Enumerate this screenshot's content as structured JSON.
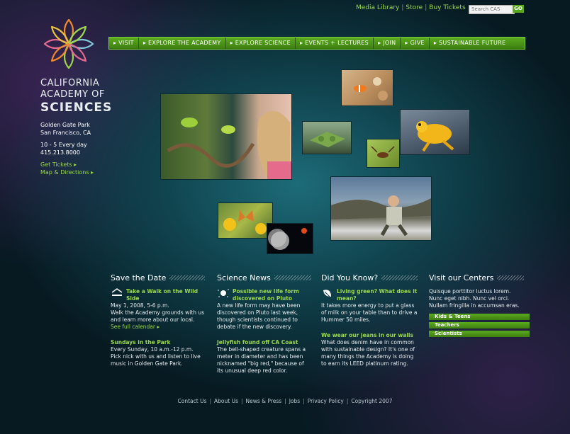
{
  "utility": {
    "links": [
      "Media Library",
      "Store",
      "Buy Tickets"
    ],
    "search_placeholder": "Search CAS",
    "go_label": "GO"
  },
  "brand": {
    "line1": "CALIFORNIA",
    "line2": "ACADEMY OF",
    "line3": "SCIENCES"
  },
  "address": {
    "line1": "Golden Gate Park",
    "line2": "San Francisco, CA",
    "hours": "10 - 5 Every day",
    "phone": "415.213.8000",
    "tickets_link": "Get Tickets ▸",
    "map_link": "Map & Directions ▸"
  },
  "nav": [
    "▸ VISIT",
    "▸ EXPLORE THE ACADEMY",
    "▸ EXPLORE SCIENCE",
    "▸ EVENTS + LECTURES",
    "▸ JOIN",
    "▸ GIVE",
    "▸ SUSTAINABLE FUTURE"
  ],
  "save_the_date": {
    "heading": "Save the Date",
    "item1_title": "Take a Walk on the Wild Side",
    "item1_date": "May 1, 2008, 5-6 p.m.",
    "item1_body": "Walk the Academy grounds with us and learn more about our local.",
    "item1_link": "See full calendar ▸",
    "item2_title": "Sundays in the Park",
    "item2_body": "Every Sunday, 10 a.m.-12 p.m. Pick nick with us and listen to live music in Golden Gate Park."
  },
  "science_news": {
    "heading": "Science News",
    "item1_title": "Possible new life form discovered on Pluto",
    "item1_body": "A new life form may have been discovered on Pluto last week, though scientists continued to debate if the new discovery.",
    "item2_title": "Jellyfish found off CA Coast",
    "item2_body": "The bell-shaped creature spans a meter in diameter and has been nicknamed \"big red,\" because of its unusual deep red color."
  },
  "did_you_know": {
    "heading": "Did You Know?",
    "item1_title": "Living green? What does it mean?",
    "item1_body": "It takes more energy to put a glass of milk on your table than to drive a Hummer 50 miles.",
    "item2_title": "We wear our jeans in our walls",
    "item2_body": "What does denim have in common with sustainable design? It's one of many things the Academy is doing to earn its LEED platinum rating."
  },
  "centers": {
    "heading": "Visit our Centers",
    "body": "Quisque porttitor luctus lorem. Nunc eget nibh. Nunc vel orci. Nullam fringilla in accumsan eras.",
    "buttons": [
      "Kids & Teens",
      "Teachers",
      "Scientists"
    ]
  },
  "footer": [
    "Contact Us",
    "About Us",
    "News & Press",
    "Jobs",
    "Privacy Policy",
    "Copyright 2007"
  ],
  "colors": {
    "accent_green": "#9bd84a",
    "nav_green": "#4c9418",
    "bg_teal": "#10444f"
  }
}
